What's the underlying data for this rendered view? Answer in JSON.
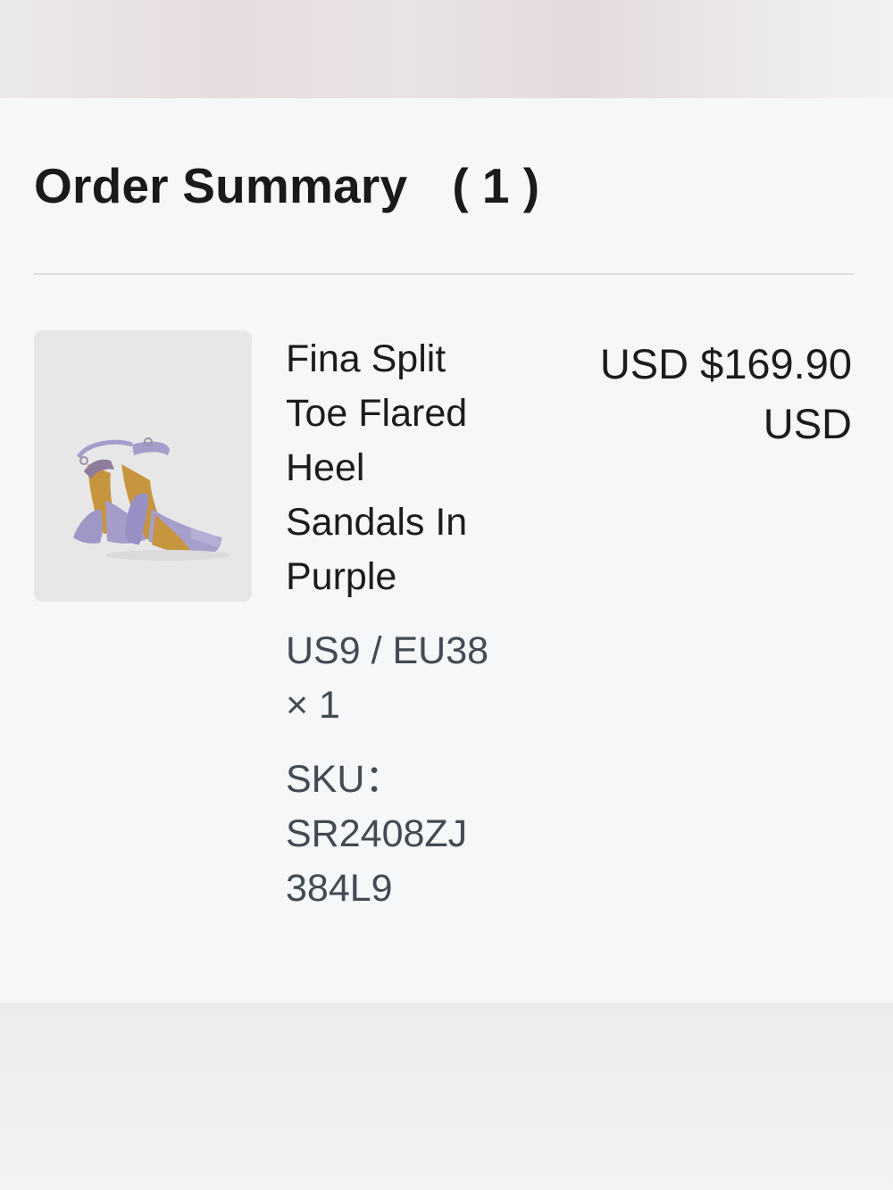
{
  "order_summary": {
    "title": "Order Summary",
    "count": "( 1 )"
  },
  "item": {
    "image_icon": "sandal-product-image",
    "name": "Fina Split Toe Flared Heel Sandals In Purple",
    "size": "US9 / EU38",
    "quantity": "× 1",
    "sku": "SKU： SR2408ZJ 384L9",
    "price": "USD $169.90 USD"
  },
  "colors": {
    "card_background": "#f5f7f8",
    "title_text": "#1a1a1a",
    "secondary_text": "#434a54",
    "divider": "#dedbe3",
    "sandal_purple": "#9e98c6",
    "sandal_tan": "#c8953f"
  }
}
